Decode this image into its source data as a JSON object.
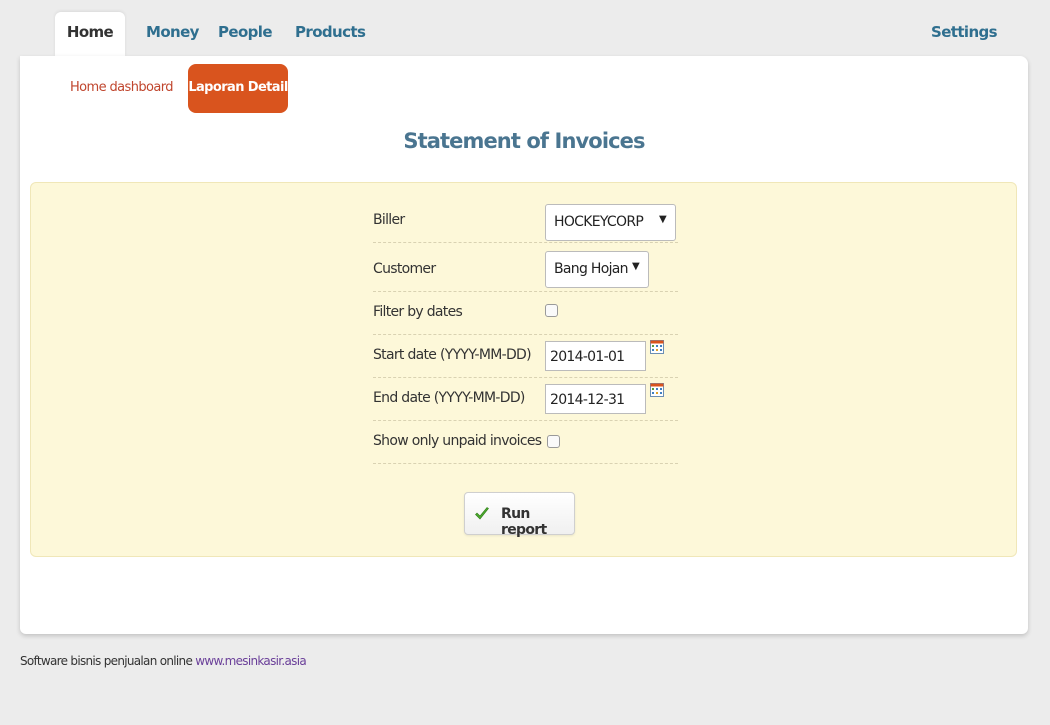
{
  "nav": {
    "tabs": [
      {
        "label": "Home",
        "active": true
      },
      {
        "label": "Money"
      },
      {
        "label": "People"
      },
      {
        "label": "Products"
      }
    ],
    "settings_label": "Settings"
  },
  "subnav": {
    "home_dashboard_label": "Home dashboard",
    "active_label": "Laporan Detail"
  },
  "page": {
    "title": "Statement of Invoices"
  },
  "form": {
    "biller": {
      "label": "Biller",
      "value": "HOCKEYCORP"
    },
    "customer": {
      "label": "Customer",
      "value": "Bang Hojan"
    },
    "filter_by_dates": {
      "label": "Filter by dates",
      "checked": false
    },
    "start_date": {
      "label": "Start date (YYYY-MM-DD)",
      "value": "2014-01-01"
    },
    "end_date": {
      "label": "End date (YYYY-MM-DD)",
      "value": "2014-12-31"
    },
    "show_unpaid": {
      "label": "Show only unpaid invoices",
      "checked": false
    },
    "run_label": "Run report"
  },
  "footer": {
    "text": "Software bisnis penjualan online",
    "link_text": "www.mesinkasir.asia"
  },
  "colors": {
    "accent": "#d9541e",
    "tab_text": "#2f6f8f",
    "title": "#4a7590",
    "form_bg": "#fdf8d9"
  },
  "icons": {
    "calendar": "calendar-icon",
    "checkmark": "checkmark-icon",
    "caret": "caret-down-icon"
  }
}
